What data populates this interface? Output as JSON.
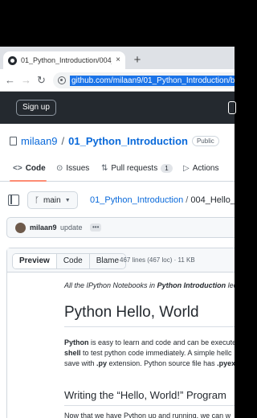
{
  "browser": {
    "tab_title": "01_Python_Introduction/004_Hel",
    "tab_close": "×",
    "new_tab": "+",
    "back": "←",
    "forward": "→",
    "reload": "↻",
    "url": "github.com/milaan9/01_Python_Introduction/blob/"
  },
  "github_header": {
    "signup_label": "Sign up"
  },
  "repo": {
    "owner": "milaan9",
    "separator": "/",
    "name": "01_Python_Introduction",
    "visibility": "Public"
  },
  "nav_tabs": [
    {
      "icon": "<>",
      "label": "Code"
    },
    {
      "icon": "⊙",
      "label": "Issues"
    },
    {
      "icon": "⇅",
      "label": "Pull requests",
      "count": "1"
    },
    {
      "icon": "▷",
      "label": "Actions"
    }
  ],
  "branch": {
    "icon": "ᚴ",
    "name": "main",
    "caret": "▼"
  },
  "breadcrumb": {
    "repo_link": "01_Python_Introduction",
    "separator": "/",
    "file": "004_Hello_W"
  },
  "commit": {
    "user": "milaan9",
    "message": "update",
    "dots": "•••"
  },
  "file_toolbar": {
    "preview": "Preview",
    "code": "Code",
    "blame": "Blame",
    "info": "467 lines (467 loc) · 11 KB"
  },
  "notebook": {
    "intro_prefix": "All the IPython Notebooks in ",
    "intro_bold": "Python Introduction",
    "intro_suffix": " lec",
    "heading": "Python Hello, World",
    "p1_line1_bold": "Python",
    "p1_line1_rest": " is easy to learn and code and can be execute",
    "p1_line2_bold": "shell",
    "p1_line2_rest": " to test python code immediately. A simple hellc",
    "p1_line3_prefix": "save with ",
    "p1_line3_bold1": ".py",
    "p1_line3_mid": " extension. Python source file has ",
    "p1_line3_bold2": ".pyex",
    "subheading": "Writing the “Hello, World!” Program",
    "p2": "Now that we have Python up and running, we can w"
  }
}
